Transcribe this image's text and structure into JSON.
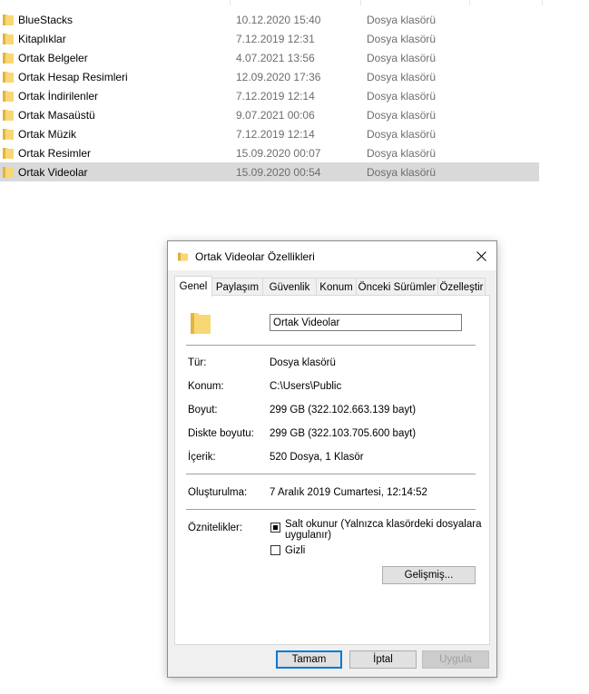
{
  "file_list": {
    "rows": [
      {
        "name": "BlueStacks",
        "date": "10.12.2020 15:40",
        "type": "Dosya klasörü",
        "selected": false
      },
      {
        "name": "Kitaplıklar",
        "date": "7.12.2019 12:31",
        "type": "Dosya klasörü",
        "selected": false
      },
      {
        "name": "Ortak Belgeler",
        "date": "4.07.2021 13:56",
        "type": "Dosya klasörü",
        "selected": false
      },
      {
        "name": "Ortak Hesap Resimleri",
        "date": "12.09.2020 17:36",
        "type": "Dosya klasörü",
        "selected": false
      },
      {
        "name": "Ortak İndirilenler",
        "date": "7.12.2019 12:14",
        "type": "Dosya klasörü",
        "selected": false
      },
      {
        "name": "Ortak Masaüstü",
        "date": "9.07.2021 00:06",
        "type": "Dosya klasörü",
        "selected": false
      },
      {
        "name": "Ortak Müzik",
        "date": "7.12.2019 12:14",
        "type": "Dosya klasörü",
        "selected": false
      },
      {
        "name": "Ortak Resimler",
        "date": "15.09.2020 00:07",
        "type": "Dosya klasörü",
        "selected": false
      },
      {
        "name": "Ortak Videolar",
        "date": "15.09.2020 00:54",
        "type": "Dosya klasörü",
        "selected": true
      }
    ],
    "icon": "folder-icon"
  },
  "dialog": {
    "title": "Ortak Videolar Özellikleri",
    "close_icon": "close-icon",
    "tabs": [
      "Genel",
      "Paylaşım",
      "Güvenlik",
      "Konum",
      "Önceki Sürümler",
      "Özelleştir"
    ],
    "active_tab": "Genel",
    "folder_name": "Ortak Videolar",
    "properties": {
      "type_label": "Tür:",
      "type_value": "Dosya klasörü",
      "location_label": "Konum:",
      "location_value": "C:\\Users\\Public",
      "size_label": "Boyut:",
      "size_value": "299 GB (322.102.663.139 bayt)",
      "disk_size_label": "Diskte boyutu:",
      "disk_size_value": "299 GB (322.103.705.600 bayt)",
      "contents_label": "İçerik:",
      "contents_value": "520 Dosya, 1 Klasör",
      "created_label": "Oluşturulma:",
      "created_value": "7 Aralık 2019 Cumartesi, 12:14:52",
      "attributes_label": "Öznitelikler:"
    },
    "attributes": {
      "readonly_label_line1": "Salt okunur (Yalnızca klasördeki dosyalara",
      "readonly_label_line2": "uygulanır)",
      "readonly_state": "indeterminate",
      "hidden_label": "Gizli",
      "hidden_checked": false
    },
    "advanced_button": "Gelişmiş...",
    "buttons": {
      "ok": "Tamam",
      "cancel": "İptal",
      "apply": "Uygula"
    }
  },
  "colors": {
    "selection": "#d9d9d9",
    "folder": "#f8d775",
    "accent": "#0078d7",
    "muted_text": "#6d6d6d"
  }
}
